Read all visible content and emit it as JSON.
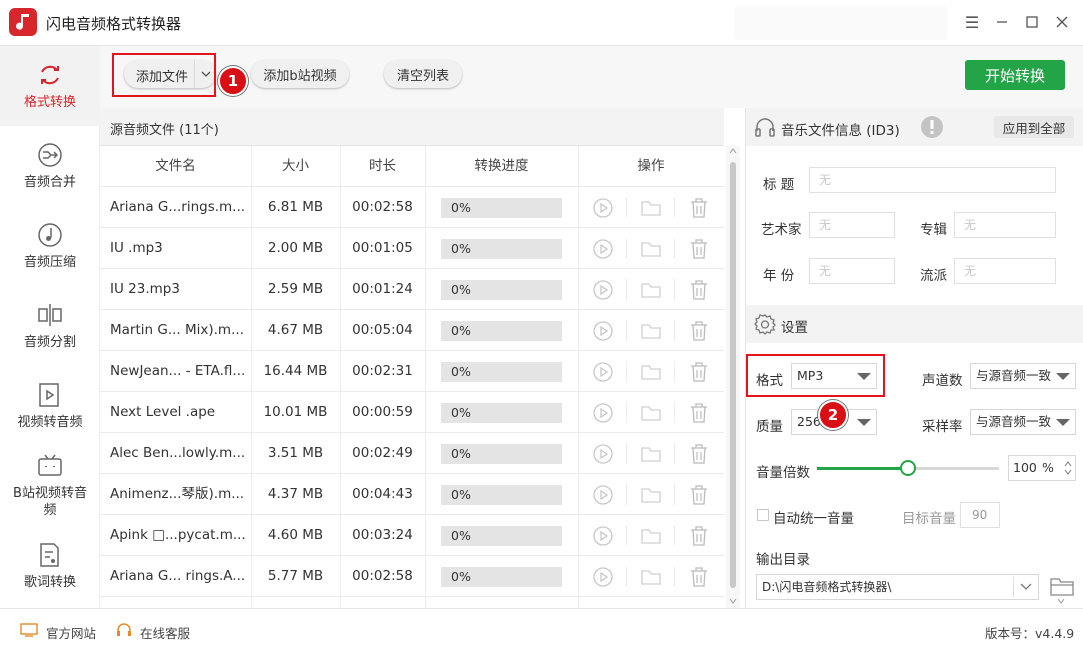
{
  "app": {
    "title": "闪电音频格式转换器"
  },
  "sidebar": {
    "items": [
      {
        "label": "格式转换",
        "icon": "refresh-icon",
        "active": true
      },
      {
        "label": "音频合并",
        "icon": "merge-icon"
      },
      {
        "label": "音频压缩",
        "icon": "compress-icon"
      },
      {
        "label": "音频分割",
        "icon": "split-icon"
      },
      {
        "label": "视频转音频",
        "icon": "video-icon"
      },
      {
        "label": "B站视频转音频",
        "icon": "tv-icon"
      },
      {
        "label": "歌词转换",
        "icon": "lyrics-icon"
      }
    ]
  },
  "toolbar": {
    "add_file": "添加文件",
    "add_bilibili": "添加b站视频",
    "clear_list": "清空列表",
    "start": "开始转换"
  },
  "annotations": {
    "step1": "1",
    "step2": "2"
  },
  "file_list": {
    "title": "源音频文件 (11个)",
    "headers": {
      "name": "文件名",
      "size": "大小",
      "duration": "时长",
      "progress": "转换进度",
      "actions": "操作"
    },
    "rows": [
      {
        "name": "Ariana G...rings.m...",
        "size": "6.81 MB",
        "duration": "00:02:58",
        "progress": "0%"
      },
      {
        "name": "IU .mp3",
        "size": "2.00 MB",
        "duration": "00:01:05",
        "progress": "0%"
      },
      {
        "name": "IU 23.mp3",
        "size": "2.59 MB",
        "duration": "00:01:24",
        "progress": "0%"
      },
      {
        "name": "Martin G... Mix).m...",
        "size": "4.67 MB",
        "duration": "00:05:04",
        "progress": "0%"
      },
      {
        "name": "NewJean... - ETA.fl...",
        "size": "16.44 MB",
        "duration": "00:02:31",
        "progress": "0%"
      },
      {
        "name": "Next Level .ape",
        "size": "10.01 MB",
        "duration": "00:00:59",
        "progress": "0%"
      },
      {
        "name": "Alec Ben...lowly.m...",
        "size": "3.51 MB",
        "duration": "00:02:49",
        "progress": "0%"
      },
      {
        "name": "Animenz...琴版).m...",
        "size": "4.37 MB",
        "duration": "00:04:43",
        "progress": "0%"
      },
      {
        "name": "Apink □...pycat.m...",
        "size": "4.60 MB",
        "duration": "00:03:24",
        "progress": "0%"
      },
      {
        "name": "Ariana G... rings.A...",
        "size": "5.77 MB",
        "duration": "00:02:58",
        "progress": "0%"
      }
    ]
  },
  "id3": {
    "title": "音乐文件信息 (ID3)",
    "apply_all": "应用到全部",
    "title_label": "标 题",
    "artist_label": "艺术家",
    "album_label": "专辑",
    "year_label": "年 份",
    "genre_label": "流派",
    "placeholder": "无"
  },
  "settings": {
    "title": "设置",
    "format_label": "格式",
    "format_value": "MP3",
    "channels_label": "声道数",
    "channels_value": "与源音频一致",
    "quality_label": "质量",
    "quality_value": "256",
    "sample_rate_label": "采样率",
    "sample_rate_value": "与源音频一致",
    "volume_label": "音量倍数",
    "volume_value": "100",
    "volume_unit": "%",
    "volume_level": 0.5,
    "auto_volume_label": "自动统一音量",
    "target_volume_label": "目标音量",
    "target_volume_value": "90",
    "output_label": "输出目录",
    "output_path": "D:\\闪电音频格式转换器\\"
  },
  "status": {
    "website": "官方网站",
    "support": "在线客服",
    "version": "版本号：v4.4.9"
  },
  "colors": {
    "brand": "#d7262c",
    "start": "#22a447",
    "slider": "#22a447",
    "annotation": "#e0151d"
  }
}
